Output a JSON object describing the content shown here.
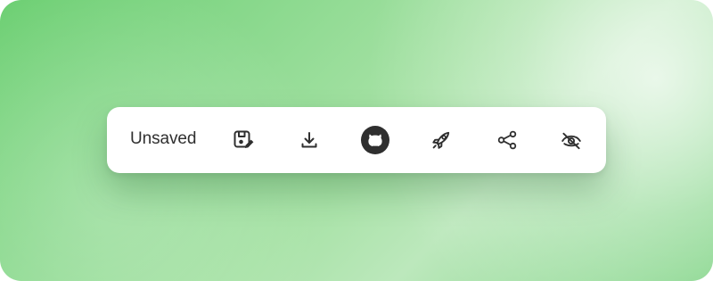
{
  "toolbar": {
    "status_label": "Unsaved",
    "actions": [
      {
        "name": "save-edit",
        "icon": "edit-save-icon"
      },
      {
        "name": "download",
        "icon": "download-icon"
      },
      {
        "name": "github",
        "icon": "github-icon"
      },
      {
        "name": "launch",
        "icon": "rocket-icon"
      },
      {
        "name": "share",
        "icon": "share-icon"
      },
      {
        "name": "hide",
        "icon": "eye-off-icon"
      }
    ]
  }
}
